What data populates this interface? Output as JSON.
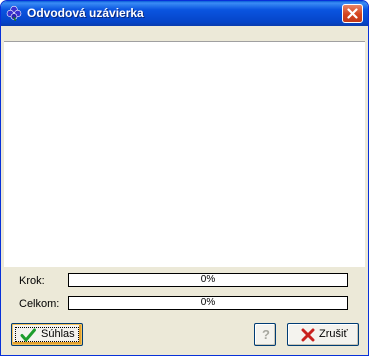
{
  "window": {
    "title": "Odvodová uzávierka"
  },
  "log": {
    "lines": []
  },
  "progress": {
    "step": {
      "label": "Krok:",
      "value": 0,
      "text": "0%"
    },
    "total": {
      "label": "Celkom:",
      "value": 0,
      "text": "0%"
    }
  },
  "buttons": {
    "ok_label": "Súhlas",
    "help_label": "?",
    "cancel_label": "Zrušiť"
  },
  "colors": {
    "accent": "#0a3cad",
    "ok_check": "#1e9d2e",
    "cancel_x": "#c8201c"
  },
  "icons": {
    "app": "clover-icon",
    "ok": "check-icon",
    "help": "question-icon",
    "cancel": "x-icon",
    "close": "close-icon"
  }
}
